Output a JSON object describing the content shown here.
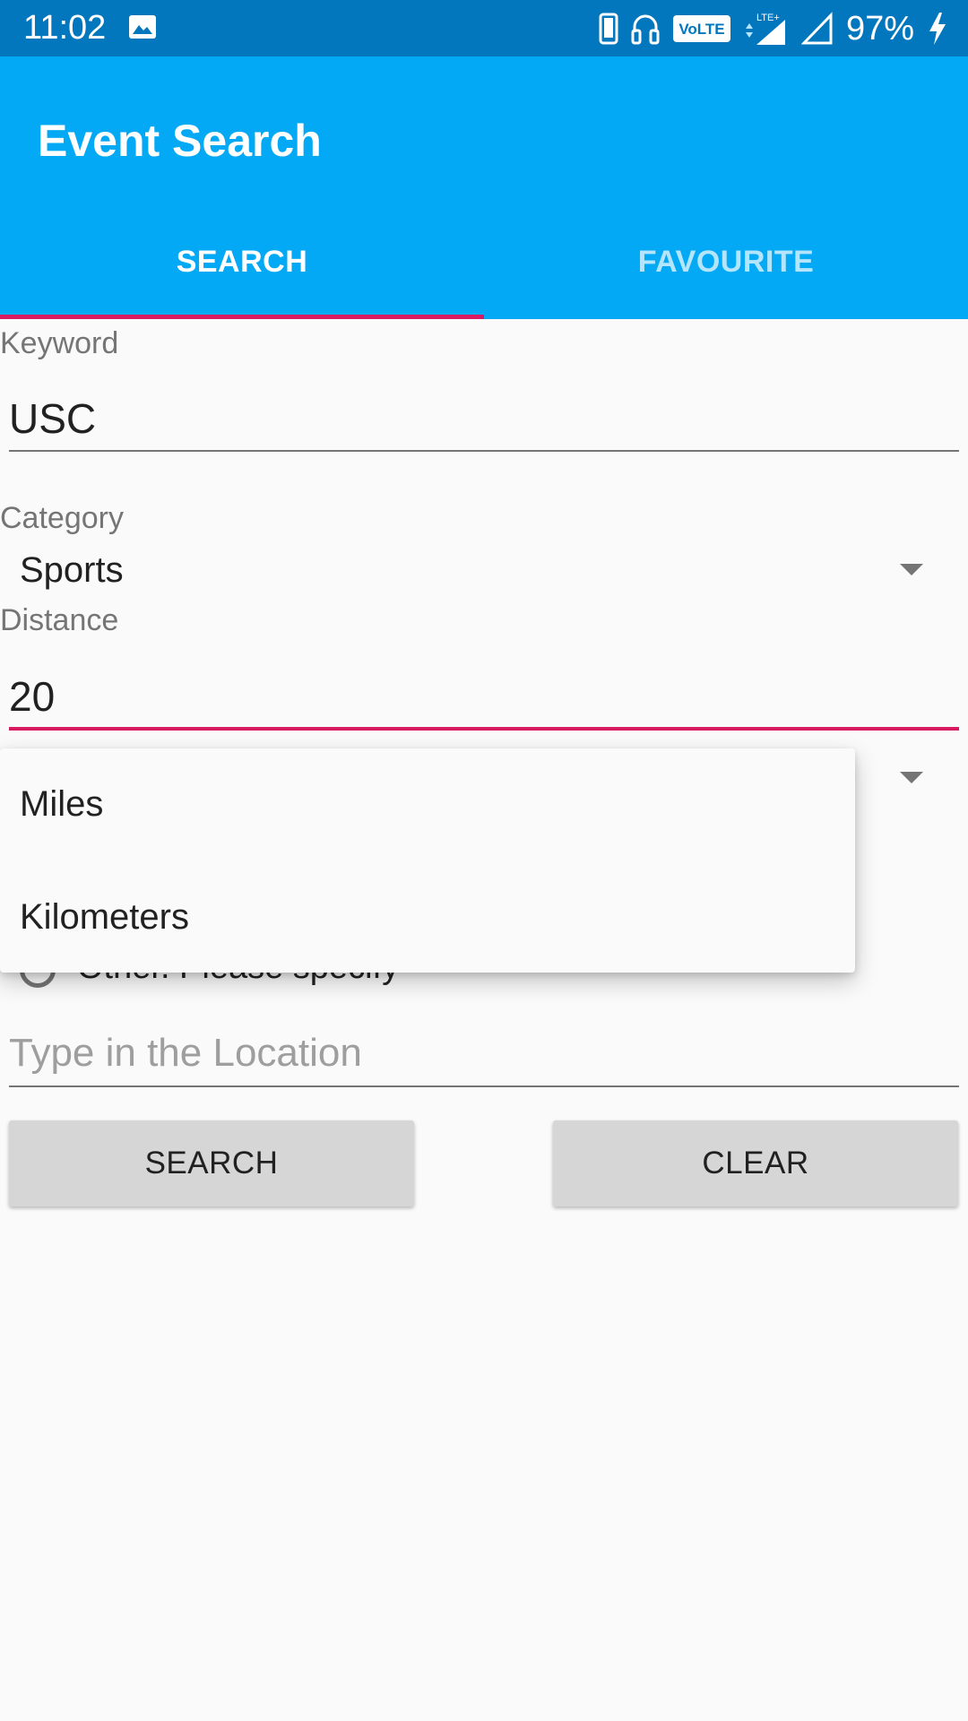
{
  "status_bar": {
    "time": "11:02",
    "battery": "97%",
    "icons": [
      "image-icon",
      "phone-icon",
      "headset-icon",
      "volte-icon",
      "lte-signal-icon",
      "signal-icon",
      "charging-icon"
    ],
    "volte_label": "VoLTE",
    "lte_label": "LTE+"
  },
  "app_bar": {
    "title": "Event Search",
    "tabs": [
      {
        "label": "SEARCH",
        "selected": true
      },
      {
        "label": "FAVOURITE",
        "selected": false
      }
    ]
  },
  "form": {
    "keyword": {
      "label": "Keyword",
      "value": "USC"
    },
    "category": {
      "label": "Category",
      "value": "Sports"
    },
    "distance": {
      "label": "Distance",
      "value": "20"
    },
    "location_option_other": "Other. Please specify",
    "location_placeholder": "Type in the Location"
  },
  "units_dropdown": {
    "options": [
      "Miles",
      "Kilometers"
    ]
  },
  "buttons": {
    "search": "SEARCH",
    "clear": "CLEAR"
  },
  "colors": {
    "status_bar": "#0277bd",
    "app_bar": "#03a9f4",
    "accent": "#d81b60",
    "button": "#d6d6d6"
  }
}
